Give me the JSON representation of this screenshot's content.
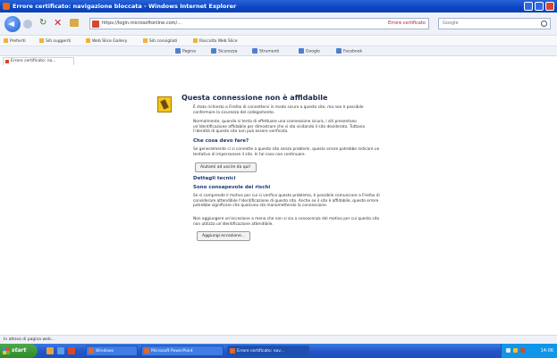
{
  "window": {
    "title": "Errore certificato: navigazione bloccata - Windows Internet Explorer"
  },
  "navbar": {
    "url": "https://login.microsoftonline.com/...",
    "cert_error": "Errore certificato",
    "search_placeholder": "Google"
  },
  "favorites": {
    "items": [
      {
        "label": "Preferiti"
      },
      {
        "label": "Siti suggeriti"
      },
      {
        "label": "Web Slice Gallery"
      },
      {
        "label": "Siti consigliati"
      },
      {
        "label": "Raccolta Web Slice"
      }
    ]
  },
  "commands": {
    "items": [
      {
        "label": "Pagina"
      },
      {
        "label": "Sicurezza"
      },
      {
        "label": "Strumenti"
      },
      {
        "label": "Google"
      },
      {
        "label": "Facebook"
      }
    ]
  },
  "tab": {
    "label": "Errore certificato: na..."
  },
  "page": {
    "title": "Questa connessione non è affidabile",
    "intro": "È stato richiesto a Firefox di connettersi in modo sicuro a questo sito, ma non è possibile confermare la sicurezza del collegamento.",
    "normally": "Normalmente, quando si tenta di effettuare una connessione sicura, i siti presentano un'identificazione affidabile per dimostrare che si sta visitando il sito desiderato. Tuttavia l'identità di questo sito non può essere verificata.",
    "what_to_do_heading": "Che cosa devo fare?",
    "what_to_do_text": "Se generalmente ci si connette a questo sito senza problemi, questo errore potrebbe indicare un tentativo di impersonare il sito. In tal caso non continuare.",
    "get_me_out_button": "Aiutami ad uscire da qui!",
    "technical_details_heading": "Dettagli tecnici",
    "understand_risks_heading": "Sono consapevole dei rischi",
    "understand_risks_text": "Se si comprende il motivo per cui si verifica questo problema, è possibile comunicare a Firefox di considerare attendibile l'identificazione di questo sito. Anche se il sito è affidabile, questo errore potrebbe significare che qualcuno sta manomettendo la connessione.",
    "exception_text": "Non aggiungere un'eccezione a meno che non si sia a conoscenza del motivo per cui questo sito non utilizza un'identificazione attendibile.",
    "add_exception_button": "Aggiungi eccezione..."
  },
  "statusbar": {
    "text": "In attesa di pagina web..."
  },
  "taskbar": {
    "start_label": "start",
    "tasks": [
      {
        "label": "Windows"
      },
      {
        "label": "Microsoft PowerPoint"
      },
      {
        "label": "Errore certificato: nav..."
      }
    ],
    "clock": "14:06"
  }
}
